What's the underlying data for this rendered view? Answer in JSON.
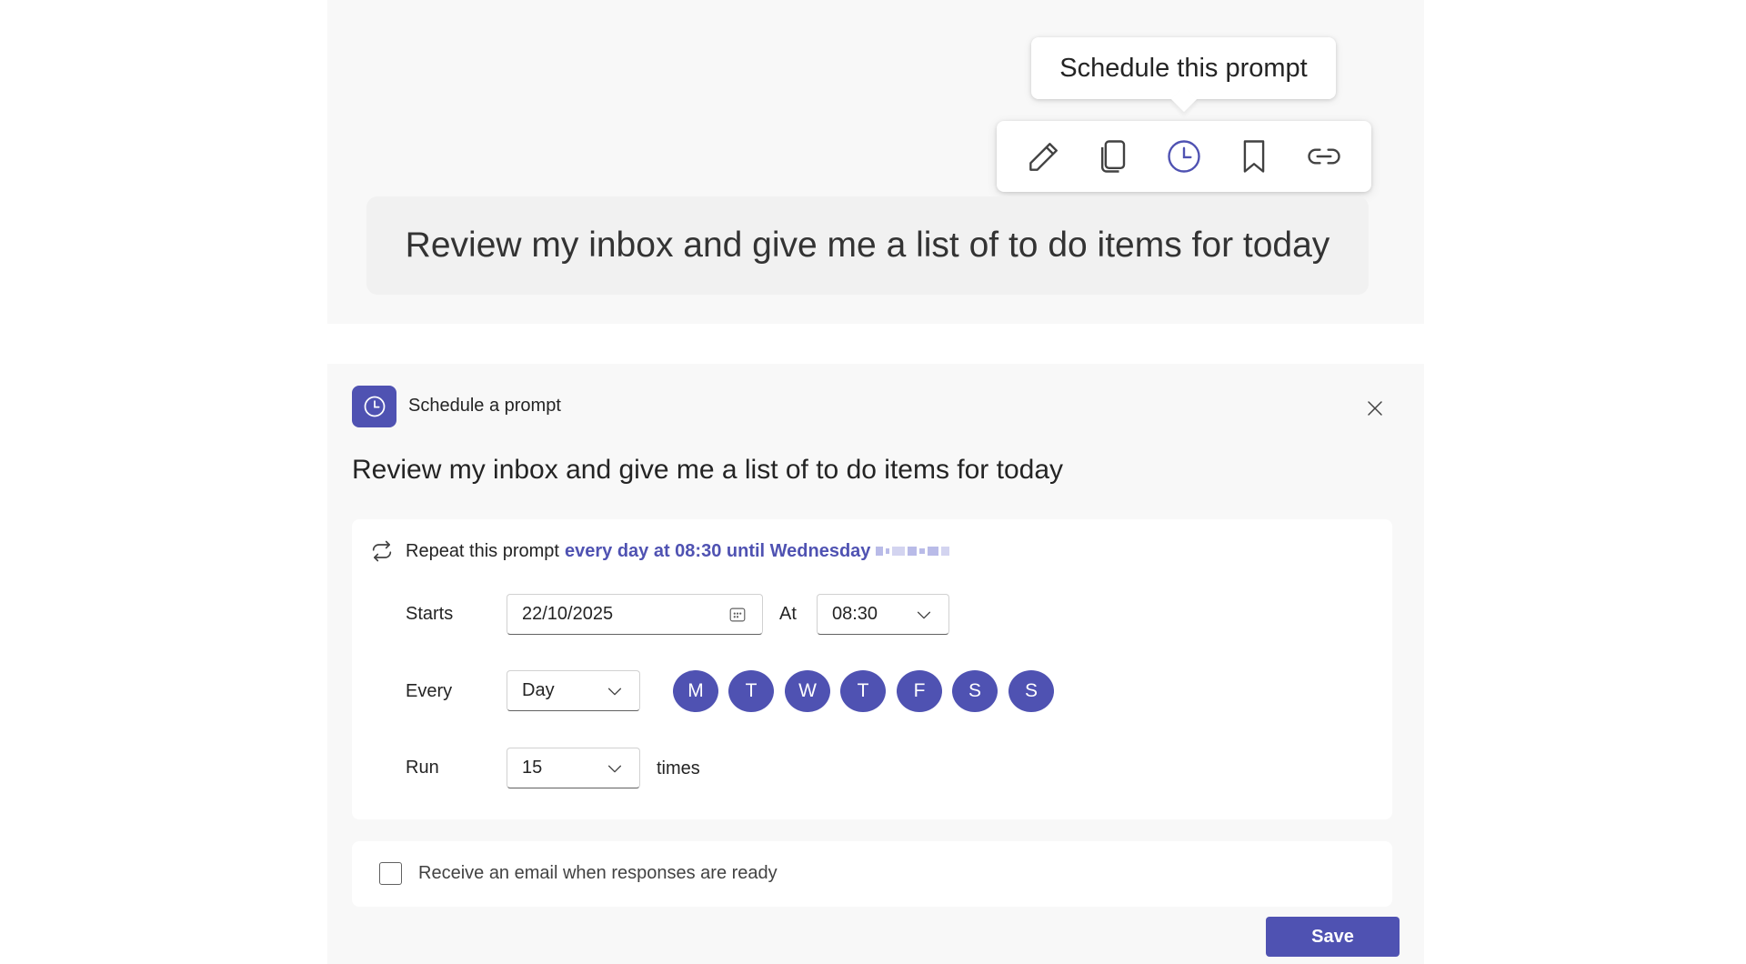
{
  "preview": {
    "tooltip": "Schedule this prompt",
    "toolbar": {
      "icons": [
        "pencil-icon",
        "copy-icon",
        "clock-icon",
        "bookmark-icon",
        "link-icon"
      ],
      "active_icon": "clock-icon"
    },
    "prompt_text": "Review my inbox and give me a list of to do items for today"
  },
  "schedule": {
    "title": "Schedule a prompt",
    "prompt_text": "Review my inbox and give me a list of to do items for today",
    "repeat": {
      "prefix": "Repeat this prompt",
      "summary": "every day at 08:30 until Wednesday"
    },
    "starts": {
      "label": "Starts",
      "date_value": "22/10/2025"
    },
    "at": {
      "label": "At",
      "time_value": "08:30"
    },
    "every": {
      "label": "Every",
      "unit_value": "Day",
      "days": [
        "M",
        "T",
        "W",
        "T",
        "F",
        "S",
        "S"
      ],
      "selected_days": [
        true,
        true,
        true,
        true,
        true,
        true,
        true
      ]
    },
    "run": {
      "label": "Run",
      "count_value": "15",
      "suffix": "times"
    },
    "email_option": {
      "label": "Receive an email when responses are ready",
      "checked": false
    },
    "save_label": "Save"
  },
  "colors": {
    "accent": "#4f52b2",
    "panel_bg": "#f8f8f8",
    "card_bg": "#ffffff",
    "text": "#242424"
  }
}
